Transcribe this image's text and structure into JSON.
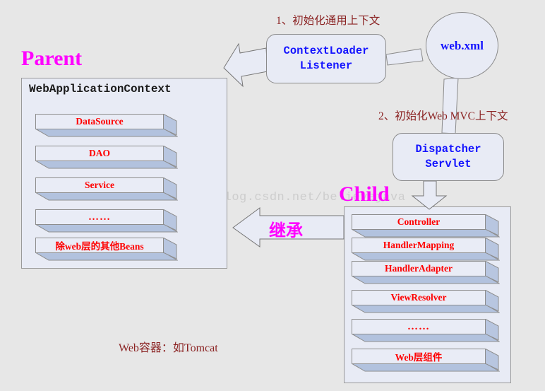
{
  "diagram": {
    "background_color": "#e7e7e7",
    "accent_color": "#ff00ff",
    "bean_text_color": "#ff0000",
    "node_text_color": "#1414ff",
    "step_text_color": "#8b2323",
    "panel_fill": "#e8ebf5",
    "shadow_color": "#b2c2de"
  },
  "watermark": {
    "text": "http://blog.csdn.net/believejava"
  },
  "parent": {
    "title": "Parent",
    "panel_caption": "WebApplicationContext",
    "beans": [
      {
        "label": "DataSource"
      },
      {
        "label": "DAO"
      },
      {
        "label": "Service"
      },
      {
        "label": "……"
      },
      {
        "label": "除web层的其他Beans"
      }
    ]
  },
  "child": {
    "title": "Child",
    "beans": [
      {
        "label": "Controller"
      },
      {
        "label": "HandlerMapping"
      },
      {
        "label": "HandlerAdapter"
      },
      {
        "label": "ViewResolver"
      },
      {
        "label": "……"
      },
      {
        "label": "Web层组件"
      }
    ]
  },
  "nodes": {
    "context_loader_listener": "ContextLoader\nListener",
    "context_loader_listener_line1": "ContextLoader",
    "context_loader_listener_line2": "Listener",
    "dispatcher_servlet_line1": "Dispatcher",
    "dispatcher_servlet_line2": "Servlet",
    "webxml": "web.xml"
  },
  "steps": {
    "step1": "1、初始化通用上下文",
    "step2": "2、初始化Web MVC上下文"
  },
  "labels": {
    "inherit": "继承",
    "web_container": "Web容器：如Tomcat"
  }
}
